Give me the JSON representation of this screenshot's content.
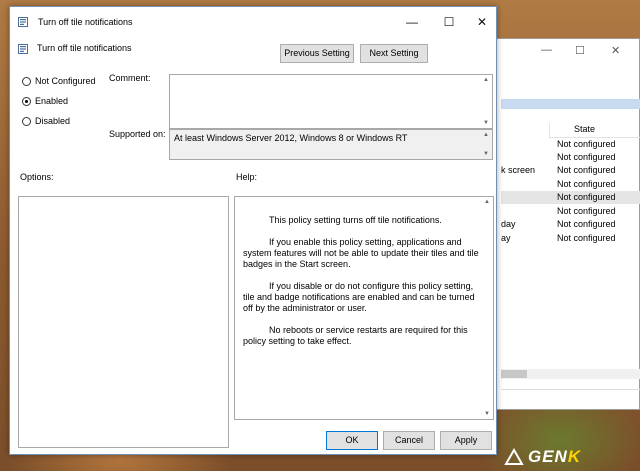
{
  "dialog": {
    "title": "Turn off tile notifications",
    "header_title": "Turn off tile notifications",
    "prev_button": "Previous Setting",
    "next_button": "Next Setting",
    "radios": [
      {
        "label": "Not Configured",
        "checked": false
      },
      {
        "label": "Enabled",
        "checked": true
      },
      {
        "label": "Disabled",
        "checked": false
      }
    ],
    "comment_label": "Comment:",
    "comment_value": "",
    "supported_label": "Supported on:",
    "supported_value": "At least Windows Server 2012, Windows 8 or Windows RT",
    "options_label": "Options:",
    "help_label": "Help:",
    "help_paragraphs": [
      "This policy setting turns off tile notifications.",
      "If you enable this policy setting, applications and system features will not be able to update their tiles and tile badges in the Start screen.",
      "If you disable or do not configure this policy setting, tile and badge notifications are enabled and can be turned off by the administrator or user.",
      "No reboots or service restarts are required for this policy setting to take effect."
    ],
    "ok_button": "OK",
    "cancel_button": "Cancel",
    "apply_button": "Apply"
  },
  "background_window": {
    "state_header": "State",
    "rows": [
      {
        "name": "",
        "state": "Not configured"
      },
      {
        "name": "",
        "state": "Not configured"
      },
      {
        "name": "k screen",
        "state": "Not configured"
      },
      {
        "name": "",
        "state": "Not configured"
      },
      {
        "name": "",
        "state": "Not configured"
      },
      {
        "name": "",
        "state": "Not configured"
      },
      {
        "name": "day",
        "state": "Not configured"
      },
      {
        "name": "ay",
        "state": "Not configured"
      }
    ]
  },
  "watermark": {
    "text_main": "GEN",
    "text_accent": "K"
  },
  "colors": {
    "accent": "#0078d7",
    "title_border": "#6f8fb5",
    "selection": "#c8daf0"
  }
}
